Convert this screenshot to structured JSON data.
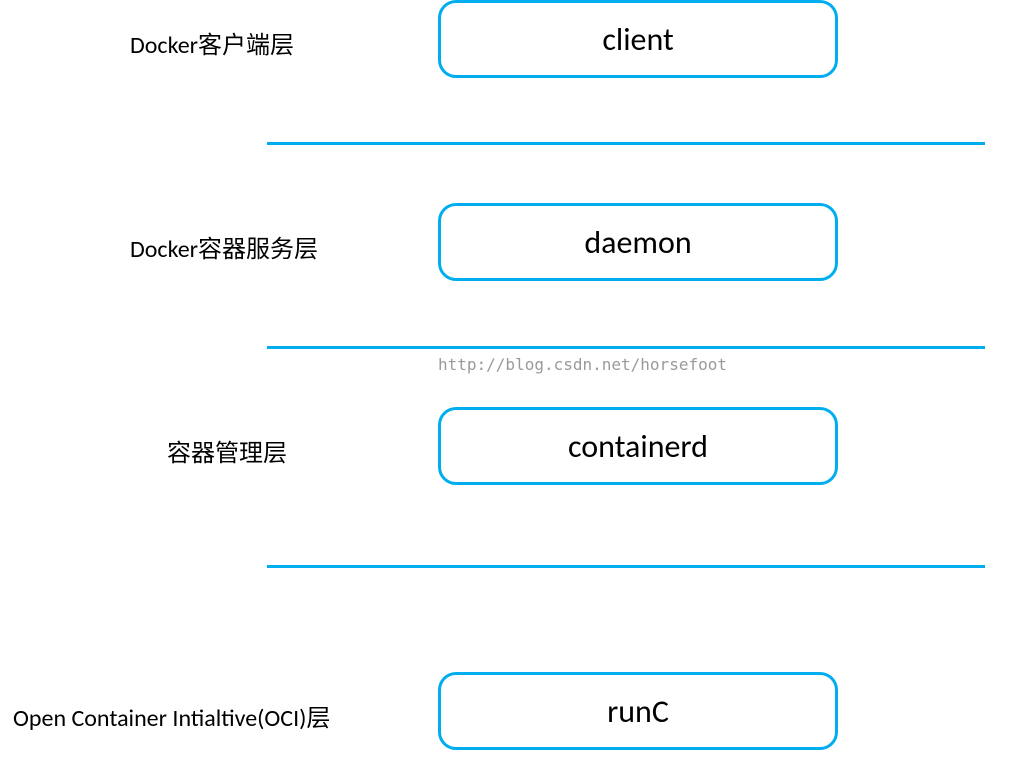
{
  "layers": [
    {
      "label": "Docker客户端层",
      "box": "client"
    },
    {
      "label": "Docker容器服务层",
      "box": "daemon"
    },
    {
      "label": "容器管理层",
      "box": "containerd"
    },
    {
      "label": "Open Container Intialtive(OCI)层",
      "box": "runC"
    }
  ],
  "watermark": "http://blog.csdn.net/horsefoot",
  "colors": {
    "accent": "#00aeef",
    "text": "#000000",
    "watermark": "#9a9a9a"
  }
}
